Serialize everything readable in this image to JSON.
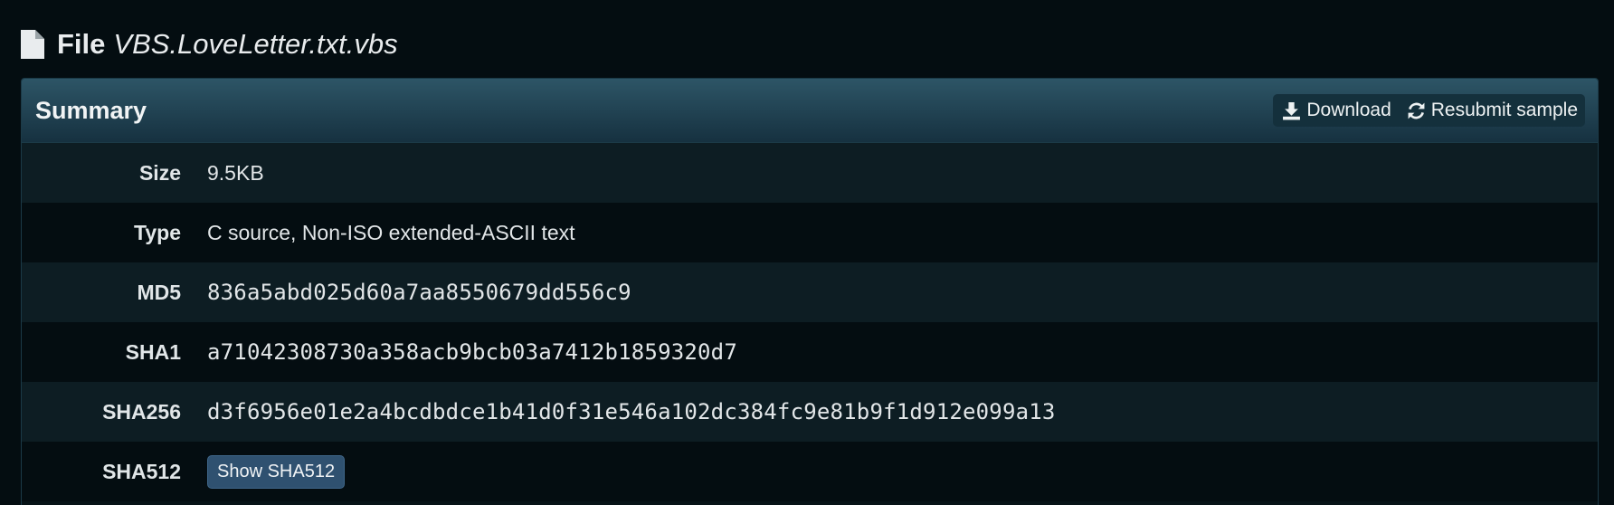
{
  "file": {
    "label": "File",
    "name": "VBS.LoveLetter.txt.vbs",
    "icon": "file-icon"
  },
  "summary": {
    "title": "Summary",
    "actions": {
      "download_label": "Download",
      "download_icon": "download-icon",
      "resubmit_label": "Resubmit sample",
      "resubmit_icon": "refresh-icon"
    },
    "rows": [
      {
        "key": "Size",
        "value": "9.5KB"
      },
      {
        "key": "Type",
        "value": "C source, Non-ISO extended-ASCII text"
      },
      {
        "key": "MD5",
        "value": "836a5abd025d60a7aa8550679dd556c9"
      },
      {
        "key": "SHA1",
        "value": "a71042308730a358acb9bcb03a7412b1859320d7"
      },
      {
        "key": "SHA256",
        "value": "d3f6956e01e2a4bcdbdce1b41d0f31e546a102dc384fc9e81b9f1d912e099a13"
      },
      {
        "key": "SHA512",
        "button_label": "Show SHA512"
      }
    ]
  },
  "colors": {
    "background": "#040d11",
    "panel_heading": "#2d5566",
    "show_button": "#2f5170"
  }
}
